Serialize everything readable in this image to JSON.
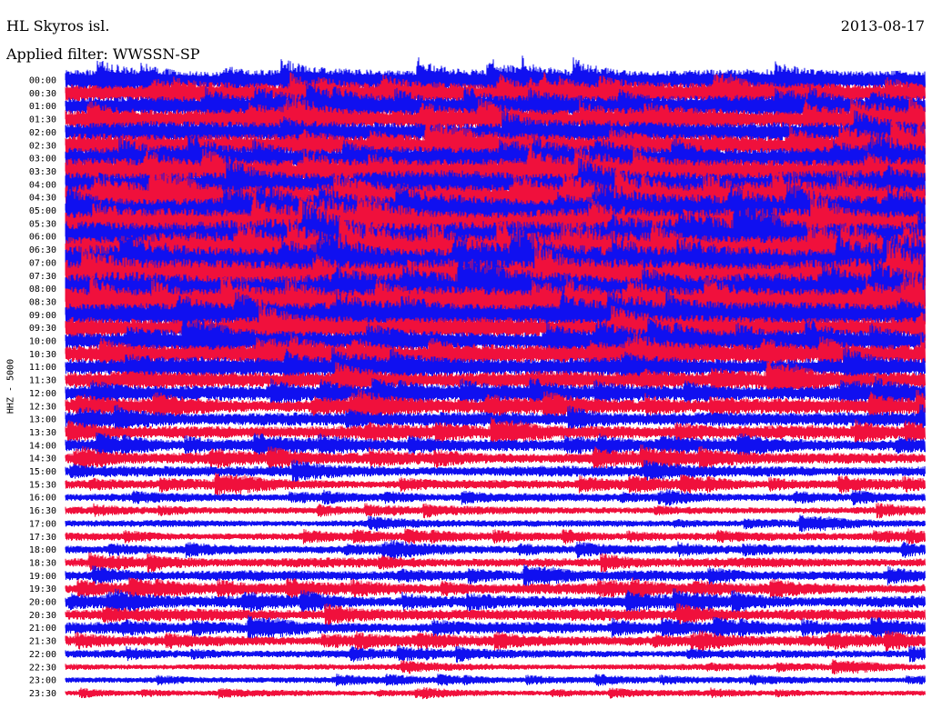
{
  "header": {
    "station": "HL Skyros isl.",
    "date": "2013-08-17",
    "filter": "Applied filter: WWSSN-SP"
  },
  "chart_data": {
    "type": "line",
    "title": "HL Skyros isl.",
    "date": "2013-08-17",
    "filter": "Applied filter: WWSSN-SP",
    "channel_label": "HHZ - 5000",
    "row_labels": [
      "00:00",
      "00:30",
      "01:00",
      "01:30",
      "02:00",
      "02:30",
      "03:00",
      "03:30",
      "04:00",
      "04:30",
      "05:00",
      "05:30",
      "06:00",
      "06:30",
      "07:00",
      "07:30",
      "08:00",
      "08:30",
      "09:00",
      "09:30",
      "10:00",
      "10:30",
      "11:00",
      "11:30",
      "12:00",
      "12:30",
      "13:00",
      "13:30",
      "14:00",
      "14:30",
      "15:00",
      "15:30",
      "16:00",
      "16:30",
      "17:00",
      "17:30",
      "18:00",
      "18:30",
      "19:00",
      "19:30",
      "20:00",
      "20:30",
      "21:00",
      "21:30",
      "22:00",
      "22:30",
      "23:00",
      "23:30"
    ],
    "colors": [
      "#1010f0",
      "#f0103c"
    ],
    "relative_amplitude": [
      1.3,
      1.3,
      1.35,
      1.35,
      1.4,
      1.45,
      1.5,
      1.6,
      1.7,
      1.8,
      1.9,
      2.0,
      2.1,
      2.1,
      2.2,
      2.1,
      2.0,
      1.8,
      1.6,
      1.45,
      1.35,
      1.25,
      1.2,
      1.1,
      1.0,
      0.95,
      0.9,
      0.85,
      0.8,
      0.75,
      0.7,
      0.6,
      0.5,
      0.45,
      0.45,
      0.5,
      0.55,
      0.6,
      0.65,
      0.7,
      0.75,
      0.75,
      0.7,
      0.65,
      0.5,
      0.4,
      0.4,
      0.35
    ]
  }
}
